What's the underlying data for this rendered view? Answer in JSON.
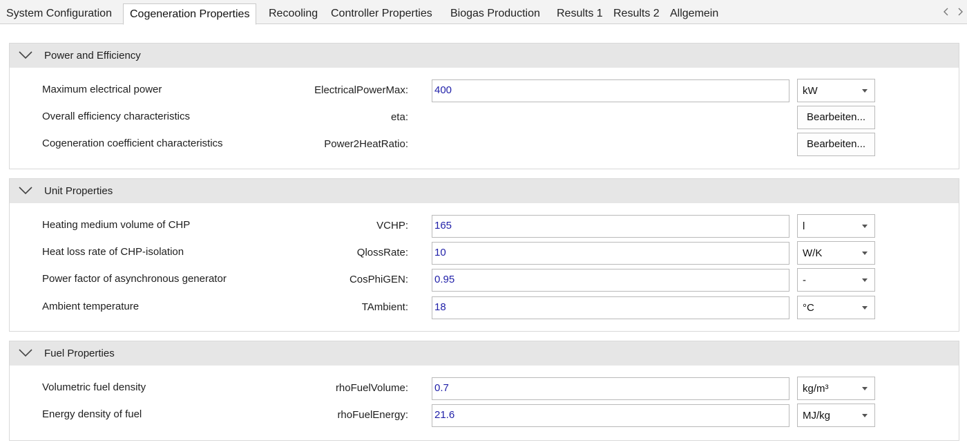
{
  "tabs": [
    {
      "label": "System Configuration"
    },
    {
      "label": "Cogeneration Properties",
      "active": true
    },
    {
      "label": "Recooling"
    },
    {
      "label": "Controller Properties"
    },
    {
      "label": "Biogas Production"
    },
    {
      "label": "Results 1"
    },
    {
      "label": "Results 2"
    },
    {
      "label": "Allgemein"
    }
  ],
  "tab_nav": {
    "prev_icon": "chevron-left-icon",
    "next_icon": "chevron-right-icon"
  },
  "sections": [
    {
      "title": "Power and Efficiency",
      "rows": [
        {
          "label": "Maximum electrical power",
          "param": "ElectricalPowerMax:",
          "value": "400",
          "unit": "kW"
        },
        {
          "label": "Overall efficiency characteristics",
          "param": "eta:",
          "button": "Bearbeiten..."
        },
        {
          "label": "Cogeneration coefficient characteristics",
          "param": "Power2HeatRatio:",
          "button": "Bearbeiten..."
        }
      ]
    },
    {
      "title": "Unit Properties",
      "rows": [
        {
          "label": "Heating medium volume of CHP",
          "param": "VCHP:",
          "value": "165",
          "unit": "l"
        },
        {
          "label": "Heat loss rate of CHP-isolation",
          "param": "QlossRate:",
          "value": "10",
          "unit": "W/K"
        },
        {
          "label": "Power factor of asynchronous generator",
          "param": "CosPhiGEN:",
          "value": "0.95",
          "unit": "-"
        },
        {
          "label": "Ambient temperature",
          "param": "TAmbient:",
          "value": "18",
          "unit": "°C"
        }
      ]
    },
    {
      "title": "Fuel Properties",
      "rows": [
        {
          "label": "Volumetric fuel density",
          "param": "rhoFuelVolume:",
          "value": "0.7",
          "unit": "kg/m³"
        },
        {
          "label": "Energy density of fuel",
          "param": "rhoFuelEnergy:",
          "value": "21.6",
          "unit": "MJ/kg"
        }
      ]
    }
  ],
  "colors": {
    "value_text": "#1f1fa8",
    "section_header": "#e6e6e6"
  }
}
